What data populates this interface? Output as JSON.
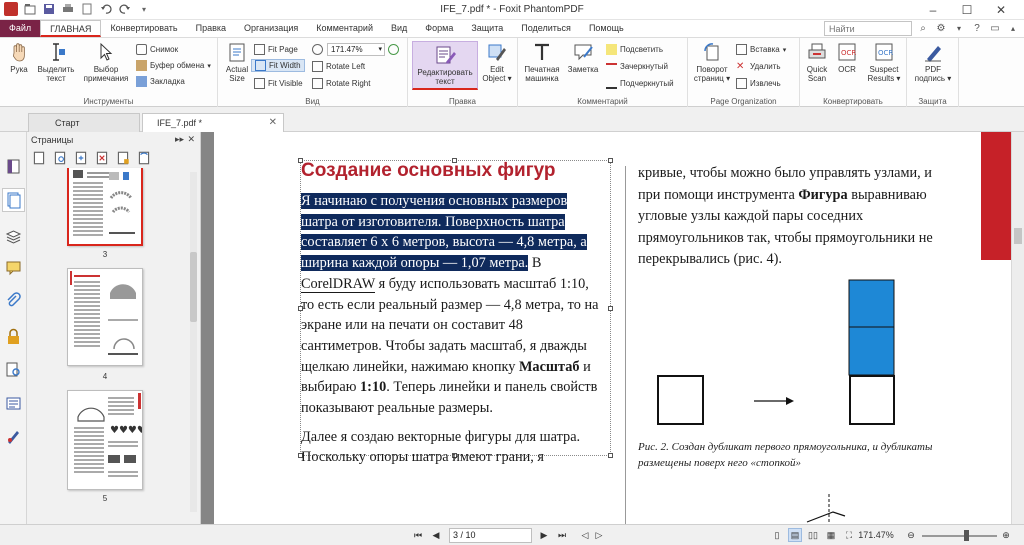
{
  "window": {
    "title": "IFE_7.pdf * - Foxit PhantomPDF"
  },
  "menu": {
    "tabs": [
      "Файл",
      "ГЛАВНАЯ",
      "Конвертировать",
      "Правка",
      "Организация",
      "Комментарий",
      "Вид",
      "Форма",
      "Защита",
      "Поделиться",
      "Помощь"
    ],
    "search_placeholder": "Найти"
  },
  "ribbon": {
    "tools": {
      "label": "Инструменты",
      "hand": "Рука",
      "select_text": "Выделить\nтекст",
      "select_annot": "Выбор\nпримечания",
      "snapshot": "Снимок",
      "clipboard": "Буфер обмена",
      "bookmark": "Закладка"
    },
    "view": {
      "label": "Вид",
      "actual_size": "Actual\nSize",
      "fit_page": "Fit Page",
      "fit_width": "Fit Width",
      "fit_visible": "Fit Visible",
      "zoom": "171.47%",
      "rotate_left": "Rotate Left",
      "rotate_right": "Rotate Right"
    },
    "edit": {
      "label": "Правка",
      "edit_text": "Редактировать\nтекст",
      "edit_object": "Edit\nObject ▾"
    },
    "comment": {
      "label": "Комментарий",
      "typewriter": "Печатная\nмашинка",
      "note": "Заметка",
      "highlight": "Подсветить",
      "strikeout": "Зачеркнутый",
      "underline": "Подчеркнутый"
    },
    "page_org": {
      "label": "Page Organization",
      "rotate_pages": "Поворот\nстраниц ▾",
      "insert": "Вставка",
      "delete": "Удалить",
      "extract": "Извлечь"
    },
    "convert": {
      "label": "Конвертировать",
      "quick_scan": "Quick\nScan",
      "ocr": "OCR",
      "suspect": "Suspect\nResults ▾"
    },
    "protect": {
      "label": "Защита",
      "pdf_sign": "PDF\nподпись ▾"
    }
  },
  "doc_tabs": [
    {
      "label": "Старт"
    },
    {
      "label": "IFE_7.pdf *"
    }
  ],
  "pages_panel": {
    "title": "Страницы",
    "thumbnails": [
      "3",
      "4",
      "5"
    ]
  },
  "document": {
    "heading": "Создание основных фигур",
    "selected": "Я начинаю с получения основных размеров шатра от изготовителя. Поверхность шатра составляет 6 х 6 метров, высота — 4,8 метра, а ширина каждой опоры — 1,07 метра.",
    "para1_a": " В ",
    "para1_b": "CorelDRAW",
    "para1_c": " я буду использовать масштаб 1:10, то есть если реальный размер — 4,8 метра, то на экране или на печати он составит 48 сантиметров. Чтобы задать масштаб, я дважды щелкаю линейки, нажимаю кнопку ",
    "para1_bold1": "Масштаб",
    "para1_d": " и выбираю ",
    "para1_bold2": "1:10",
    "para1_e": ". Теперь линейки и панель свойств показывают реальные размеры.",
    "para2": "Далее я создаю векторные фигуры для шатра. Поскольку опоры шатра имеют грани, я",
    "right_a": "кривые, чтобы можно было управлять узлами, и при помощи инструмента ",
    "right_bold": "Фигура",
    "right_b": " выравниваю угловые узлы каждой пары соседних прямоугольников так, чтобы прямоугольники не перекрывались (рис. 4).",
    "caption": "Рис. 2. Создан дубликат первого прямоугольника, и дубликаты размещены поверх него «стопкой»"
  },
  "statusbar": {
    "page": "3 / 10",
    "zoom": "171.47%"
  },
  "colors": {
    "accent": "#d9261c",
    "file_tab": "#7a2346",
    "selection": "#0f2a5c",
    "heading": "#b2222e",
    "shape_blue": "#1e88d6"
  }
}
